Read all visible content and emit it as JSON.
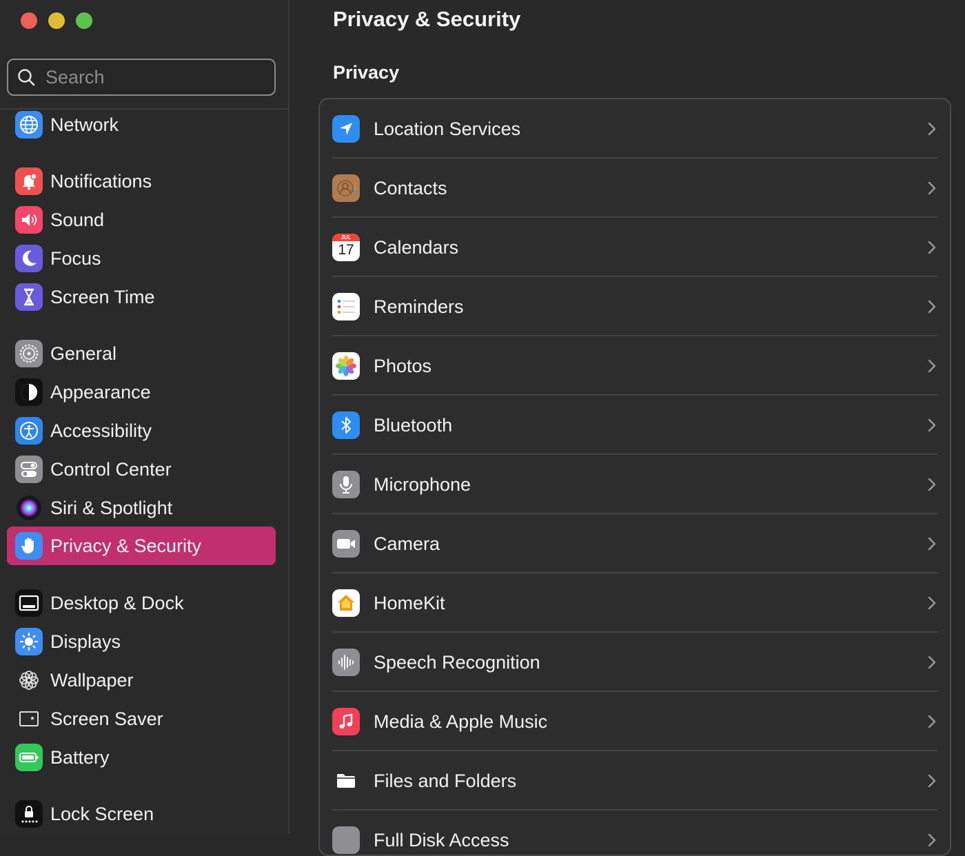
{
  "sidebar": {
    "search_placeholder": "Search",
    "items": [
      {
        "label": "Network",
        "icon": "network-icon"
      },
      {
        "label": "Notifications",
        "icon": "notifications-icon"
      },
      {
        "label": "Sound",
        "icon": "sound-icon"
      },
      {
        "label": "Focus",
        "icon": "focus-icon"
      },
      {
        "label": "Screen Time",
        "icon": "screen-time-icon"
      },
      {
        "label": "General",
        "icon": "general-icon"
      },
      {
        "label": "Appearance",
        "icon": "appearance-icon"
      },
      {
        "label": "Accessibility",
        "icon": "accessibility-icon"
      },
      {
        "label": "Control Center",
        "icon": "control-center-icon"
      },
      {
        "label": "Siri & Spotlight",
        "icon": "siri-icon"
      },
      {
        "label": "Privacy & Security",
        "icon": "privacy-hand-icon",
        "selected": true
      },
      {
        "label": "Desktop & Dock",
        "icon": "desktop-dock-icon"
      },
      {
        "label": "Displays",
        "icon": "displays-icon"
      },
      {
        "label": "Wallpaper",
        "icon": "wallpaper-icon"
      },
      {
        "label": "Screen Saver",
        "icon": "screen-saver-icon"
      },
      {
        "label": "Battery",
        "icon": "battery-icon"
      },
      {
        "label": "Lock Screen",
        "icon": "lock-screen-icon"
      }
    ]
  },
  "main": {
    "title": "Privacy & Security",
    "section": "Privacy",
    "rows": [
      {
        "label": "Location Services",
        "icon": "location-icon"
      },
      {
        "label": "Contacts",
        "icon": "contacts-icon"
      },
      {
        "label": "Calendars",
        "icon": "calendar-icon",
        "icon_month": "JUL",
        "icon_day": "17"
      },
      {
        "label": "Reminders",
        "icon": "reminders-icon"
      },
      {
        "label": "Photos",
        "icon": "photos-icon"
      },
      {
        "label": "Bluetooth",
        "icon": "bluetooth-icon"
      },
      {
        "label": "Microphone",
        "icon": "microphone-icon"
      },
      {
        "label": "Camera",
        "icon": "camera-icon"
      },
      {
        "label": "HomeKit",
        "icon": "homekit-icon"
      },
      {
        "label": "Speech Recognition",
        "icon": "speech-recognition-icon"
      },
      {
        "label": "Media & Apple Music",
        "icon": "music-icon"
      },
      {
        "label": "Files and Folders",
        "icon": "folder-icon"
      },
      {
        "label": "Full Disk Access",
        "icon": "disk-icon"
      }
    ]
  },
  "colors": {
    "accent_selected": "#c0306f",
    "window_bg": "#292929",
    "group_bg": "#2d2d2d"
  }
}
